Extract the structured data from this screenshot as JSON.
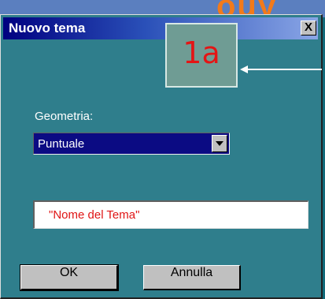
{
  "dialog": {
    "title": "Nuovo tema",
    "close_label": "X"
  },
  "annotation": {
    "label": "1a"
  },
  "geometry": {
    "label": "Geometria:",
    "selected": "Puntuale"
  },
  "theme_name": {
    "value": "\"Nome del Tema\""
  },
  "buttons": {
    "ok": "OK",
    "cancel": "Annulla"
  },
  "colors": {
    "background": "#116a7a",
    "titlebar_start": "#000080",
    "annotation_text": "#e41515",
    "field_text": "#e01515"
  },
  "icons": {
    "close": "close-icon",
    "dropdown": "chevron-down-icon",
    "arrow": "arrow-left-icon"
  }
}
